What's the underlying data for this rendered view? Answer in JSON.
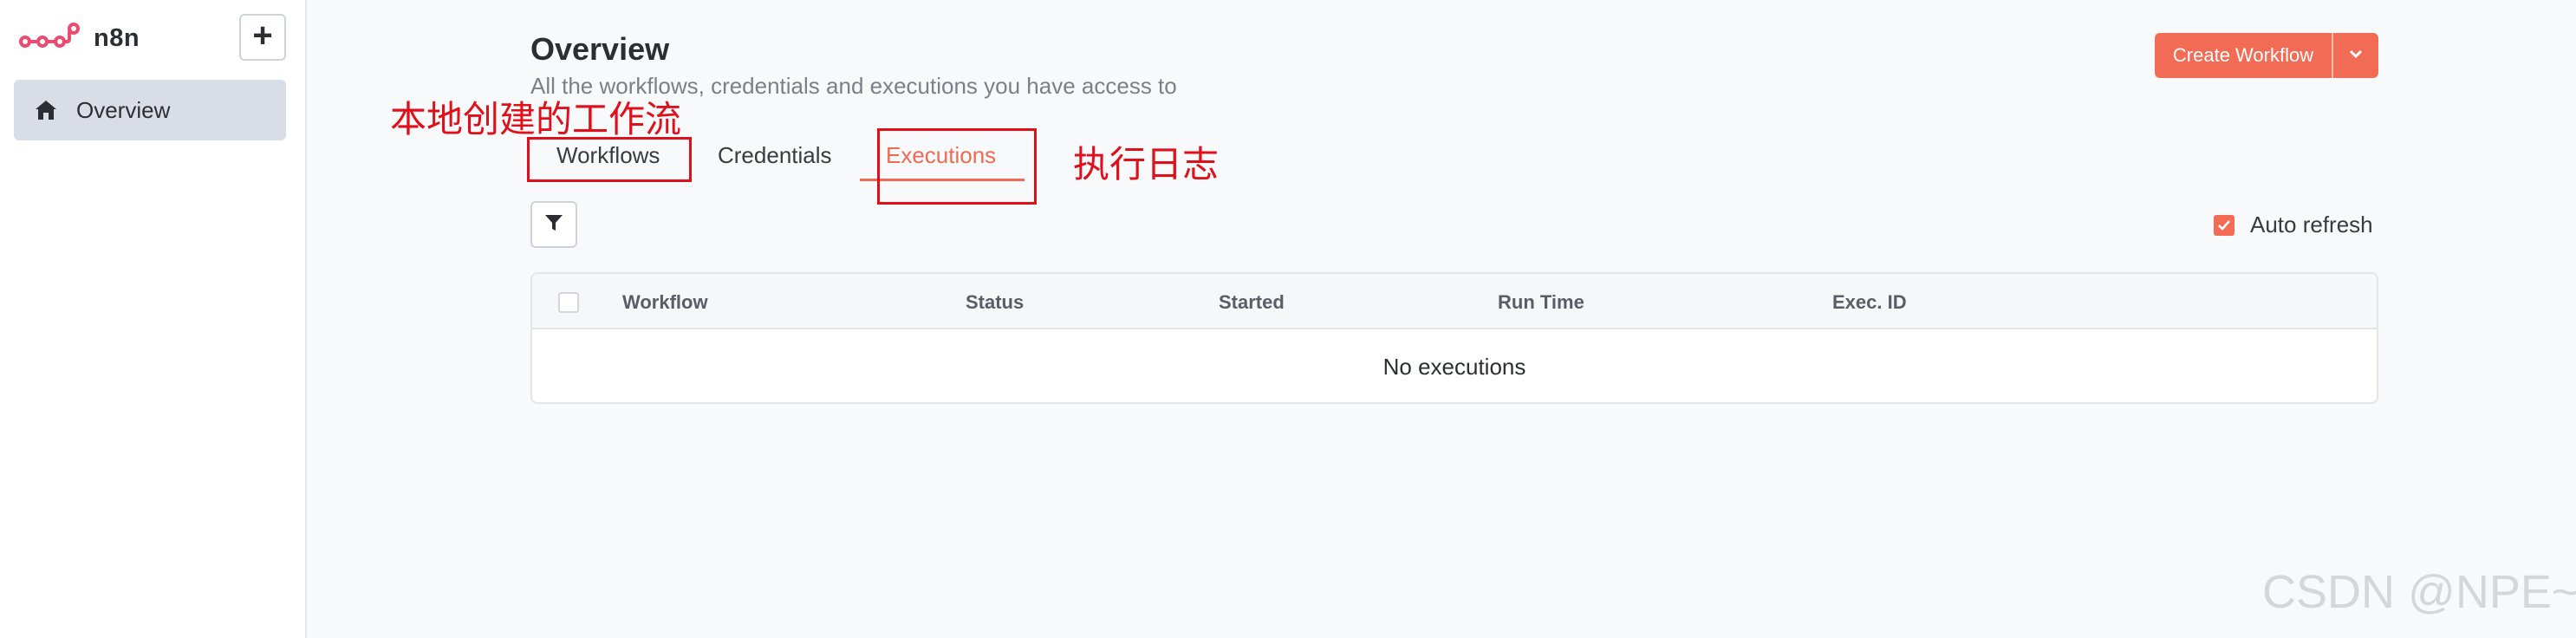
{
  "app": {
    "name": "n8n",
    "brand_color": "#ea4b71",
    "accent": "#f26b54"
  },
  "sidebar": {
    "add_icon": "plus-icon",
    "items": [
      {
        "label": "Overview",
        "icon": "home-icon",
        "active": true
      }
    ]
  },
  "header": {
    "title": "Overview",
    "subtitle": "All the workflows, credentials and executions you have access to",
    "create_label": "Create Workflow",
    "create_dropdown_icon": "chevron-down-icon"
  },
  "tabs": [
    {
      "label": "Workflows",
      "active": false
    },
    {
      "label": "Credentials",
      "active": false
    },
    {
      "label": "Executions",
      "active": true
    }
  ],
  "annotations": {
    "workflows_note": "本地创建的工作流",
    "executions_note": "执行日志"
  },
  "toolbar": {
    "filter_icon": "filter-icon",
    "auto_refresh_label": "Auto refresh",
    "auto_refresh_checked": true
  },
  "table": {
    "columns": [
      "Workflow",
      "Status",
      "Started",
      "Run Time",
      "Exec. ID"
    ],
    "empty_text": "No executions"
  },
  "watermark": "CSDN @NPE~"
}
